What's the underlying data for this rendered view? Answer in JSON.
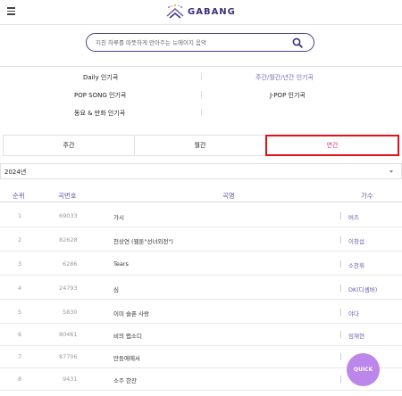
{
  "header": {
    "logo_text": "GABANG"
  },
  "search": {
    "placeholder": "지친 하루를 따뜻하게 만아주는 뉴에이지 음악"
  },
  "categories": {
    "daily": "Daily 인기곡",
    "weekly_monthly_yearly": "주간/월간/년간 인기곡",
    "pop_song": "POP SONG 인기곡",
    "jpop": "J-POP 인기곡",
    "kids_anime": "동요 & 만화 인기곡"
  },
  "tabs": [
    {
      "label": "주간"
    },
    {
      "label": "월간"
    },
    {
      "label": "연간"
    }
  ],
  "year_select": {
    "value": "2024년"
  },
  "table": {
    "headers": {
      "rank": "순위",
      "number": "곡번호",
      "title": "곡명",
      "artist": "가수"
    },
    "rows": [
      {
        "rank": "1",
        "number": "69033",
        "title": "가시",
        "artist": "버즈"
      },
      {
        "rank": "2",
        "number": "82628",
        "title": "천상연 (웹툰\"선녀외전\")",
        "artist": "이창섭"
      },
      {
        "rank": "3",
        "number": "6286",
        "title": "Tears",
        "artist": "소찬휘"
      },
      {
        "rank": "4",
        "number": "24793",
        "title": "심",
        "artist": "DK(디셈버)"
      },
      {
        "rank": "5",
        "number": "5830",
        "title": "이미 슬픈 사랑",
        "artist": "야다"
      },
      {
        "rank": "6",
        "number": "80461",
        "title": "비의 랩소디",
        "artist": "임재현"
      },
      {
        "rank": "7",
        "number": "87706",
        "title": "만둥에에서",
        "artist": ""
      },
      {
        "rank": "8",
        "number": "9431",
        "title": "소주 한잔",
        "artist": ""
      }
    ]
  },
  "quick_button": {
    "label": "QUICK"
  }
}
